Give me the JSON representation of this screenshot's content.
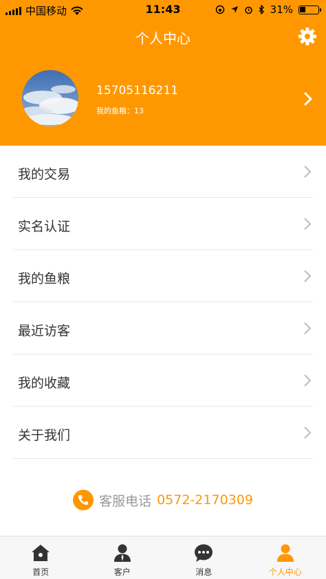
{
  "status_bar": {
    "carrier": "中国移动",
    "time": "11:43",
    "battery_text": "31%",
    "battery_level": 0.31
  },
  "nav": {
    "title": "个人中心",
    "settings_icon": "gear-icon"
  },
  "profile": {
    "phone": "15705116211",
    "fish_food": "我的鱼粮：13"
  },
  "menu": {
    "items": [
      {
        "label": "我的交易"
      },
      {
        "label": "实名认证"
      },
      {
        "label": "我的鱼粮"
      },
      {
        "label": "最近访客"
      },
      {
        "label": "我的收藏"
      },
      {
        "label": "关于我们"
      }
    ]
  },
  "service": {
    "label": "客服电话",
    "number": "0572-2170309"
  },
  "tabbar": {
    "tabs": [
      {
        "label": "首页",
        "icon": "home-icon"
      },
      {
        "label": "客户",
        "icon": "customer-icon"
      },
      {
        "label": "消息",
        "icon": "message-icon"
      },
      {
        "label": "个人中心",
        "icon": "profile-icon"
      }
    ],
    "active_index": 3
  },
  "colors": {
    "accent": "#FF9800",
    "tab_icon": "#333333"
  }
}
